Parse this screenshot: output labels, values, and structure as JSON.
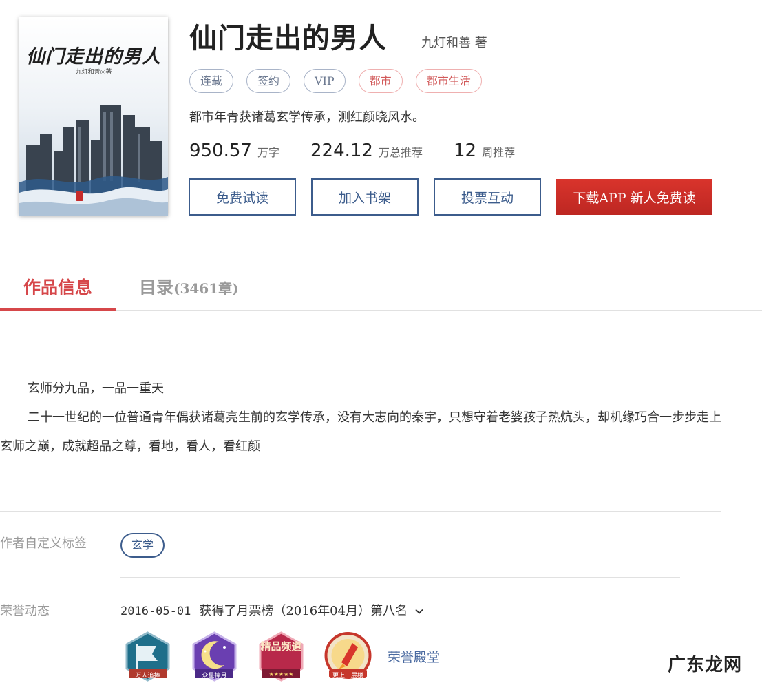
{
  "book": {
    "cover_title": "仙门走出的男人",
    "cover_author": "九灯和善◎著",
    "title": "仙门走出的男人",
    "author_line": "九灯和善 著",
    "tags": [
      {
        "label": "连载",
        "style": "gray"
      },
      {
        "label": "签约",
        "style": "gray"
      },
      {
        "label": "VIP",
        "style": "gray"
      },
      {
        "label": "都市",
        "style": "red"
      },
      {
        "label": "都市生活",
        "style": "red"
      }
    ],
    "intro": "都市年青获诸葛玄学传承，测红颜晓风水。",
    "stats": [
      {
        "value": "950.57",
        "unit": "万字"
      },
      {
        "value": "224.12",
        "unit": "万总推荐"
      },
      {
        "value": "12",
        "unit": "周推荐"
      }
    ],
    "actions": {
      "free_read": "免费试读",
      "add_shelf": "加入书架",
      "vote": "投票互动",
      "download": "下载APP  新人免费读"
    }
  },
  "tabs": {
    "info": "作品信息",
    "catalog": "目录",
    "catalog_count": "(3461章)"
  },
  "description": {
    "line1": "玄师分九品，一品一重天",
    "line2": "二十一世纪的一位普通青年偶获诸葛亮生前的玄学传承，没有大志向的秦宇，只想守着老婆孩子热炕头，却机缘巧合一步步走上玄师之巅，成就超品之尊，看地，看人，看红颜"
  },
  "custom_tags": {
    "label": "作者自定义标签",
    "tag": "玄学"
  },
  "honor": {
    "label": "荣誉动态",
    "date": "2016-05-01",
    "text": "获得了月票榜（2016年04月）第八名",
    "badges": [
      {
        "caption": "万人追捧",
        "icon": "flag-badge-icon",
        "color": "#1f6f8a"
      },
      {
        "caption": "众星捧月",
        "icon": "moon-badge-icon",
        "color": "#6a3fb1"
      },
      {
        "big": "精品频道",
        "caption": "",
        "icon": "quality-badge-icon",
        "color": "#b8294a"
      },
      {
        "caption": "更上一层楼",
        "icon": "rocket-badge-icon",
        "color": "#c6362b"
      }
    ],
    "hall_link": "荣誉殿堂"
  },
  "watermark": "广东龙网"
}
